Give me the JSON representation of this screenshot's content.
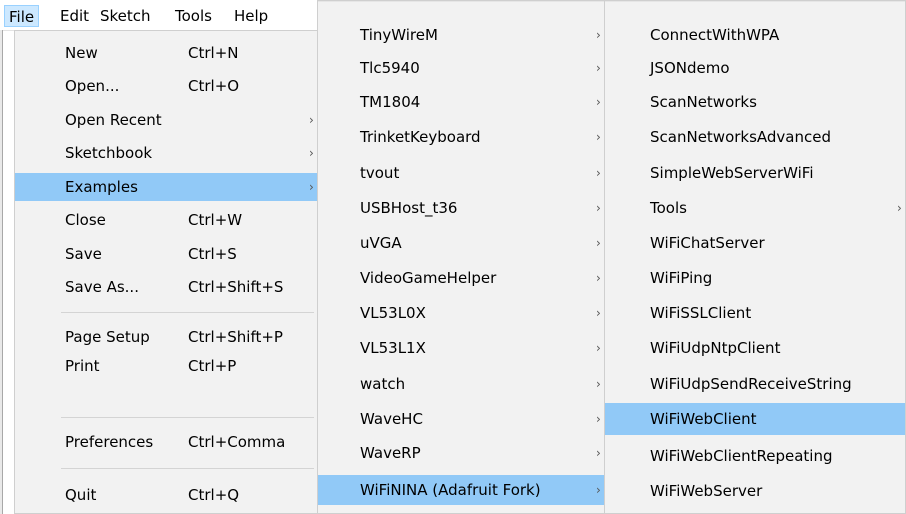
{
  "menubar": {
    "file": "File",
    "edit": "Edit",
    "sketch": "Sketch",
    "tools": "Tools",
    "help": "Help"
  },
  "file_menu": {
    "items": [
      {
        "label": "New",
        "shortcut": "Ctrl+N"
      },
      {
        "label": "Open...",
        "shortcut": "Ctrl+O"
      },
      {
        "label": "Open Recent",
        "submenu": true
      },
      {
        "label": "Sketchbook",
        "submenu": true
      },
      {
        "label": "Examples",
        "submenu": true,
        "highlighted": true
      },
      {
        "label": "Close",
        "shortcut": "Ctrl+W"
      },
      {
        "label": "Save",
        "shortcut": "Ctrl+S"
      },
      {
        "label": "Save As...",
        "shortcut": "Ctrl+Shift+S"
      },
      {
        "label": "Page Setup",
        "shortcut": "Ctrl+Shift+P"
      },
      {
        "label": "Print",
        "shortcut": "Ctrl+P"
      },
      {
        "label": "Preferences",
        "shortcut": "Ctrl+Comma"
      },
      {
        "label": "Quit",
        "shortcut": "Ctrl+Q"
      }
    ]
  },
  "examples_menu": {
    "items": [
      {
        "label": "TinyWireM"
      },
      {
        "label": "Tlc5940"
      },
      {
        "label": "TM1804"
      },
      {
        "label": "TrinketKeyboard"
      },
      {
        "label": "tvout"
      },
      {
        "label": "USBHost_t36"
      },
      {
        "label": "uVGA"
      },
      {
        "label": "VideoGameHelper"
      },
      {
        "label": "VL53L0X"
      },
      {
        "label": "VL53L1X"
      },
      {
        "label": "watch"
      },
      {
        "label": "WaveHC"
      },
      {
        "label": "WaveRP"
      },
      {
        "label": "WiFiNINA (Adafruit Fork)",
        "highlighted": true
      }
    ]
  },
  "wifinina_menu": {
    "items": [
      {
        "label": "ConnectWithWPA"
      },
      {
        "label": "JSONdemo"
      },
      {
        "label": "ScanNetworks"
      },
      {
        "label": "ScanNetworksAdvanced"
      },
      {
        "label": "SimpleWebServerWiFi"
      },
      {
        "label": "Tools",
        "submenu": true
      },
      {
        "label": "WiFiChatServer"
      },
      {
        "label": "WiFiPing"
      },
      {
        "label": "WiFiSSLClient"
      },
      {
        "label": "WiFiUdpNtpClient"
      },
      {
        "label": "WiFiUdpSendReceiveString"
      },
      {
        "label": "WiFiWebClient",
        "highlighted": true
      },
      {
        "label": "WiFiWebClientRepeating"
      },
      {
        "label": "WiFiWebServer"
      }
    ]
  },
  "icons": {
    "submenu_arrow": "chevron-right-icon"
  }
}
